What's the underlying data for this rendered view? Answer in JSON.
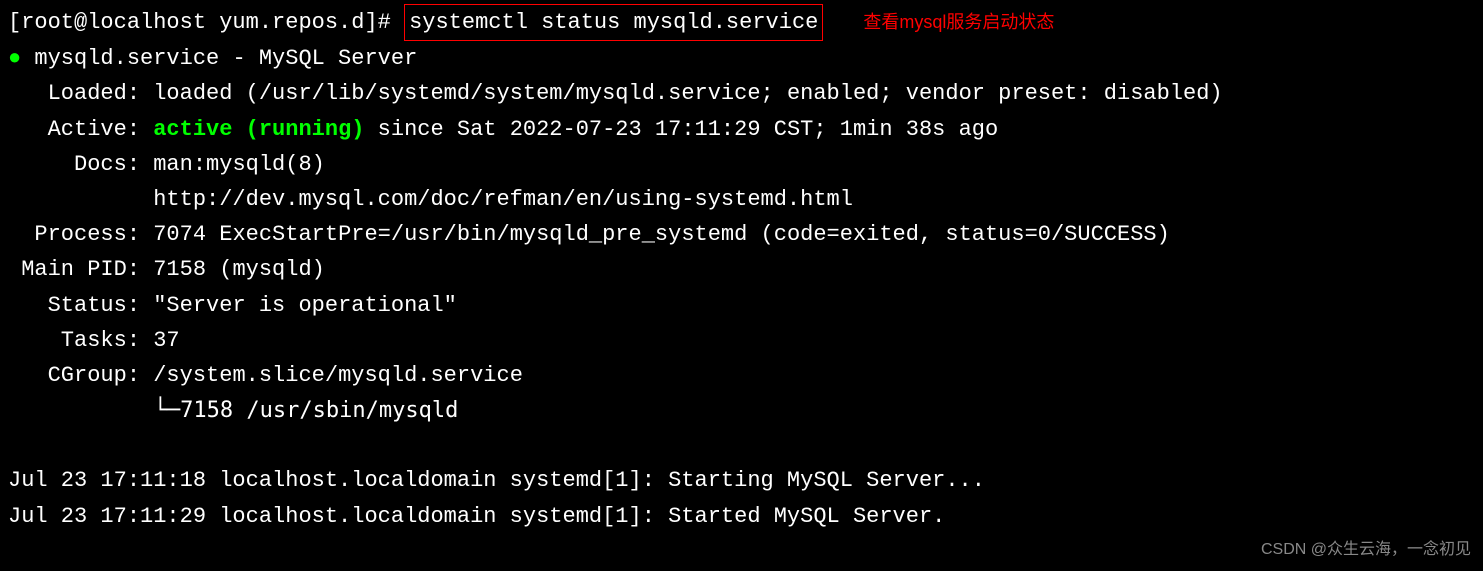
{
  "prompt": "[root@localhost yum.repos.d]#",
  "command": "systemctl status mysqld.service",
  "annotation": "查看mysql服务启动状态",
  "service_header": "mysqld.service - MySQL Server",
  "loaded": {
    "label": "   Loaded:",
    "value": "loaded (/usr/lib/systemd/system/mysqld.service; enabled; vendor preset: disabled)"
  },
  "active": {
    "label": "   Active:",
    "status": "active (running)",
    "since": "since Sat 2022-07-23 17:11:29 CST; 1min 38s ago"
  },
  "docs": {
    "label": "     Docs:",
    "line1": "man:mysqld(8)",
    "line2": "           http://dev.mysql.com/doc/refman/en/using-systemd.html"
  },
  "process": {
    "label": "  Process:",
    "value": "7074 ExecStartPre=/usr/bin/mysqld_pre_systemd (code=exited, status=0/SUCCESS)"
  },
  "main_pid": {
    "label": " Main PID:",
    "value": "7158 (mysqld)"
  },
  "status": {
    "label": "   Status:",
    "value": "\"Server is operational\""
  },
  "tasks": {
    "label": "    Tasks:",
    "value": "37"
  },
  "cgroup": {
    "label": "   CGroup:",
    "value": "/system.slice/mysqld.service",
    "tree": "           └─7158 /usr/sbin/mysqld"
  },
  "journal": {
    "line1": "Jul 23 17:11:18 localhost.localdomain systemd[1]: Starting MySQL Server...",
    "line2": "Jul 23 17:11:29 localhost.localdomain systemd[1]: Started MySQL Server."
  },
  "watermark": "CSDN @众生云海，一念初见"
}
